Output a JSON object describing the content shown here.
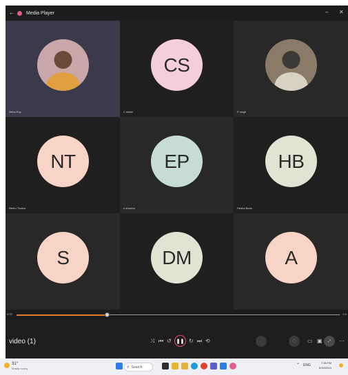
{
  "window": {
    "title": "Media Player",
    "minimize_glyph": "–",
    "close_glyph": "✕"
  },
  "participants": [
    {
      "initials": "",
      "name": "Neha Roy",
      "avatar": "photo",
      "bg": "#c9a7a8"
    },
    {
      "initials": "CS",
      "name": "C sinha",
      "avatar": "initials",
      "bg": "#f4cfd9"
    },
    {
      "initials": "",
      "name": "P singh",
      "avatar": "photo",
      "bg": "#8a7a68"
    },
    {
      "initials": "NT",
      "name": "Neetu Thakur",
      "avatar": "initials",
      "bg": "#f7d4c6"
    },
    {
      "initials": "EP",
      "name": "e.sharma",
      "avatar": "initials",
      "bg": "#c7ddd3"
    },
    {
      "initials": "HB",
      "name": "Hesha Bank",
      "avatar": "initials",
      "bg": "#e3e3d4"
    },
    {
      "initials": "S",
      "name": "",
      "avatar": "initials",
      "bg": "#f7d4c6"
    },
    {
      "initials": "DM",
      "name": "",
      "avatar": "initials",
      "bg": "#e3e3d4"
    },
    {
      "initials": "A",
      "name": "",
      "avatar": "initials",
      "bg": "#f7d4c6"
    }
  ],
  "tile_colors": {
    "dark": "#282828",
    "darker": "#1f1f1f",
    "active": "#3a3a4a"
  },
  "seek": {
    "time_elapsed": "0:33",
    "time_total": "0:0",
    "progress_fraction": 0.28,
    "fill_color": "#e07a2e"
  },
  "player": {
    "title": "video (1)",
    "shuffle_glyph": "⤨",
    "prev_glyph": "⏮",
    "back_glyph": "↺",
    "pause_glyph": "❚❚",
    "forward_glyph": "↻",
    "next_glyph": "⏭",
    "repeat_glyph": "⟲",
    "cast_glyph": "▭",
    "miniplayer_glyph": "▣",
    "fullscreen_glyph": "⤢",
    "more_glyph": "⋯"
  },
  "taskbar": {
    "weather_temp": "31°",
    "weather_text": "Mostly sunny",
    "search_label": "Search",
    "tray_text": "ENG",
    "time": "7:38 PM",
    "date": "8/15/2024",
    "icons": [
      {
        "name": "windows-start",
        "color": "#2b7de9"
      },
      {
        "name": "task-view",
        "color": "#2f2f2f"
      },
      {
        "name": "widgets",
        "color": "#e8b42b"
      },
      {
        "name": "file-explorer",
        "color": "#e6b23a"
      },
      {
        "name": "edge",
        "color": "#1b9bd8"
      },
      {
        "name": "chrome",
        "color": "#e34133"
      },
      {
        "name": "teams",
        "color": "#5b5fc7"
      },
      {
        "name": "store",
        "color": "#2b7de9"
      },
      {
        "name": "media-player",
        "color": "#e35c8c"
      }
    ]
  }
}
